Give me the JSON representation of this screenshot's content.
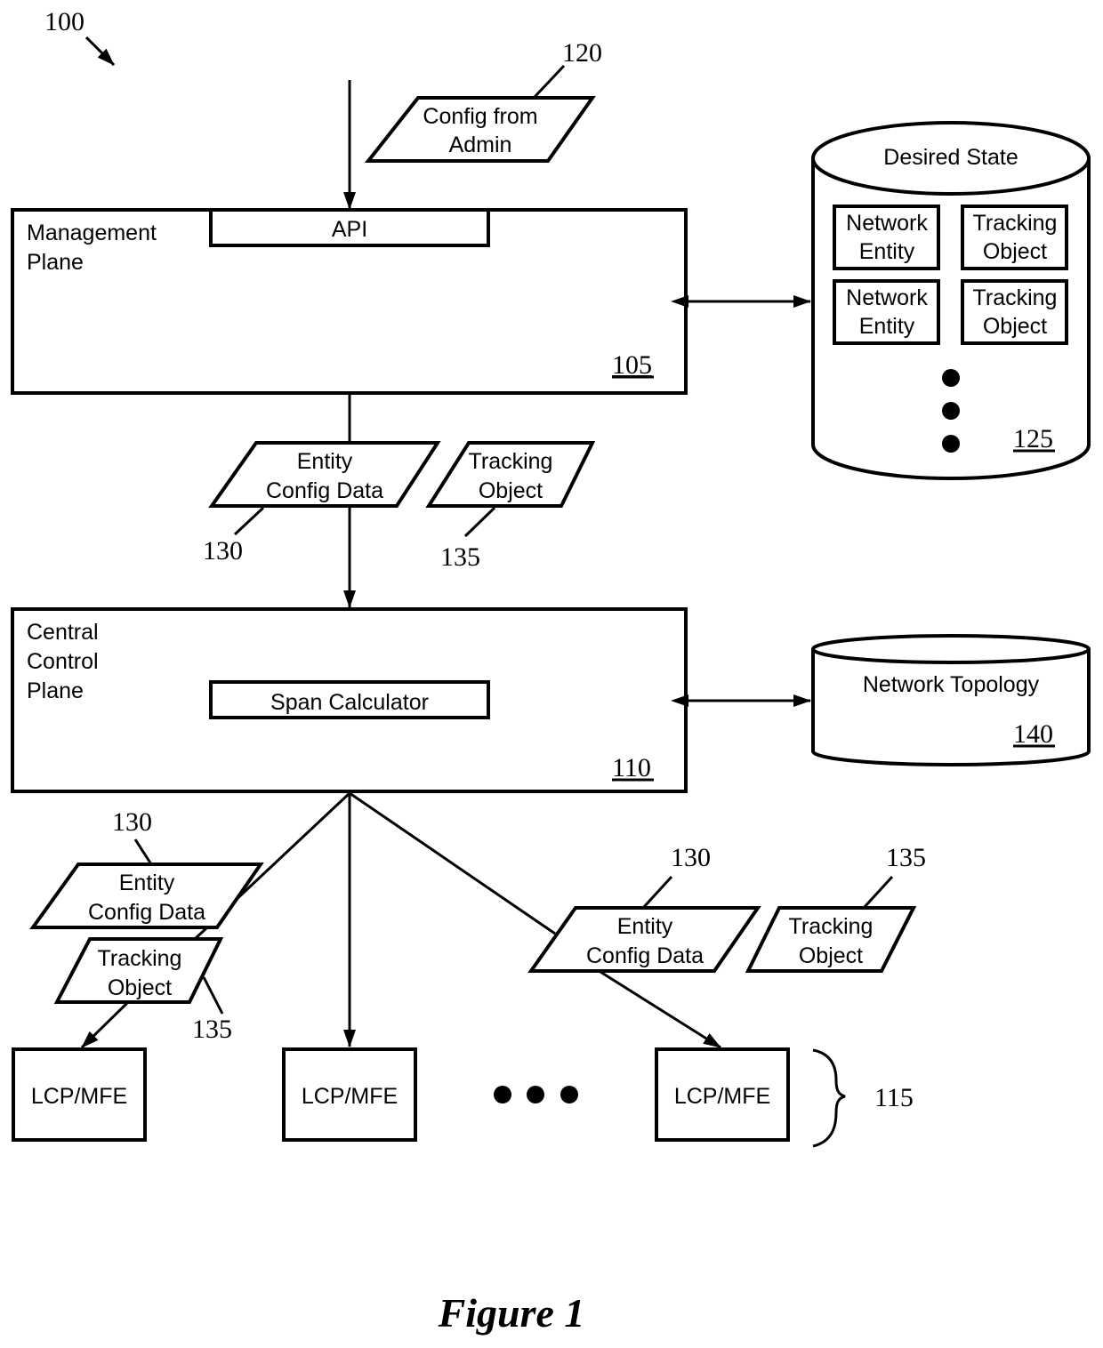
{
  "figure": {
    "ref": "100",
    "caption": "Figure 1"
  },
  "config_from_admin": {
    "line1": "Config from",
    "line2": "Admin",
    "ref": "120"
  },
  "management_plane": {
    "line1": "Management",
    "line2": "Plane",
    "api_label": "API",
    "ref": "105"
  },
  "desired_state": {
    "title": "Desired State",
    "ref": "125",
    "entries": [
      {
        "line1": "Network",
        "line2": "Entity"
      },
      {
        "line1": "Tracking",
        "line2": "Object"
      },
      {
        "line1": "Network",
        "line2": "Entity"
      },
      {
        "line1": "Tracking",
        "line2": "Object"
      }
    ]
  },
  "entity_config": {
    "line1": "Entity",
    "line2": "Config Data",
    "ref": "130"
  },
  "tracking_object": {
    "line1": "Tracking",
    "line2": "Object",
    "ref": "135"
  },
  "central_control_plane": {
    "line1": "Central",
    "line2": "Control",
    "line3": "Plane",
    "span_label": "Span Calculator",
    "ref": "110"
  },
  "network_topology": {
    "title": "Network Topology",
    "ref": "140"
  },
  "lcp_mfe": {
    "label": "LCP/MFE",
    "group_ref": "115"
  }
}
